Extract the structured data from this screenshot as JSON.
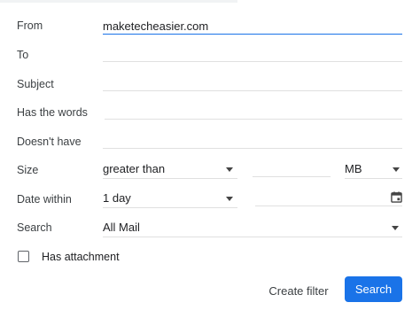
{
  "form": {
    "from": {
      "label": "From",
      "value": "maketecheasier.com"
    },
    "to": {
      "label": "To",
      "value": ""
    },
    "subject": {
      "label": "Subject",
      "value": ""
    },
    "has_words": {
      "label": "Has the words",
      "value": ""
    },
    "doesnt_have": {
      "label": "Doesn't have",
      "value": ""
    },
    "size": {
      "label": "Size",
      "comparator": "greater than",
      "amount": "",
      "unit": "MB"
    },
    "date_within": {
      "label": "Date within",
      "range": "1 day",
      "date": ""
    },
    "search": {
      "label": "Search",
      "scope": "All Mail"
    },
    "has_attachment": {
      "label": "Has attachment",
      "checked": false
    }
  },
  "buttons": {
    "create_filter": "Create filter",
    "search": "Search"
  },
  "colors": {
    "accent": "#1a73e8",
    "divider": "#e0e0e0",
    "text": "#202124"
  },
  "icons": {
    "dropdown": "chevron-down-icon",
    "calendar": "calendar-icon",
    "checkbox": "checkbox-icon"
  }
}
